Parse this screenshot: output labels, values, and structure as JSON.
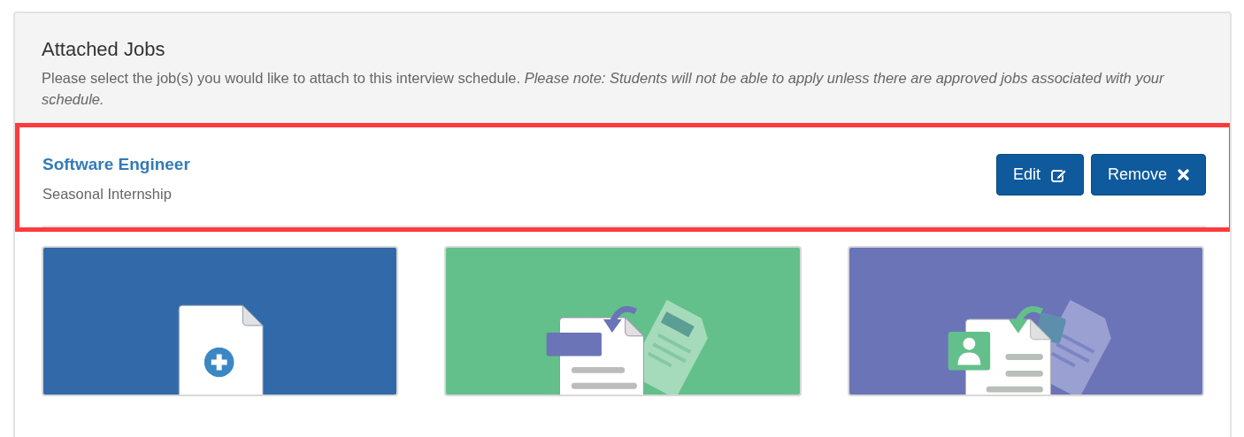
{
  "section": {
    "title": "Attached Jobs",
    "description": "Please select the job(s) you would like to attach to this interview schedule. *Please note: Students will not be able to apply unless there are approved jobs associated with your schedule.*"
  },
  "jobs": [
    {
      "title": "Software Engineer",
      "subtitle": "Seasonal Internship",
      "highlighted": true,
      "buttons": [
        {
          "label": "Edit",
          "kind": "edit"
        },
        {
          "label": "Remove",
          "kind": "remove"
        }
      ]
    }
  ],
  "tiles": [
    {
      "kind": "new",
      "color": "#3169a9"
    },
    {
      "kind": "copy",
      "color": "#63c08b"
    },
    {
      "kind": "copy-profile",
      "color": "#6b74b6"
    }
  ]
}
